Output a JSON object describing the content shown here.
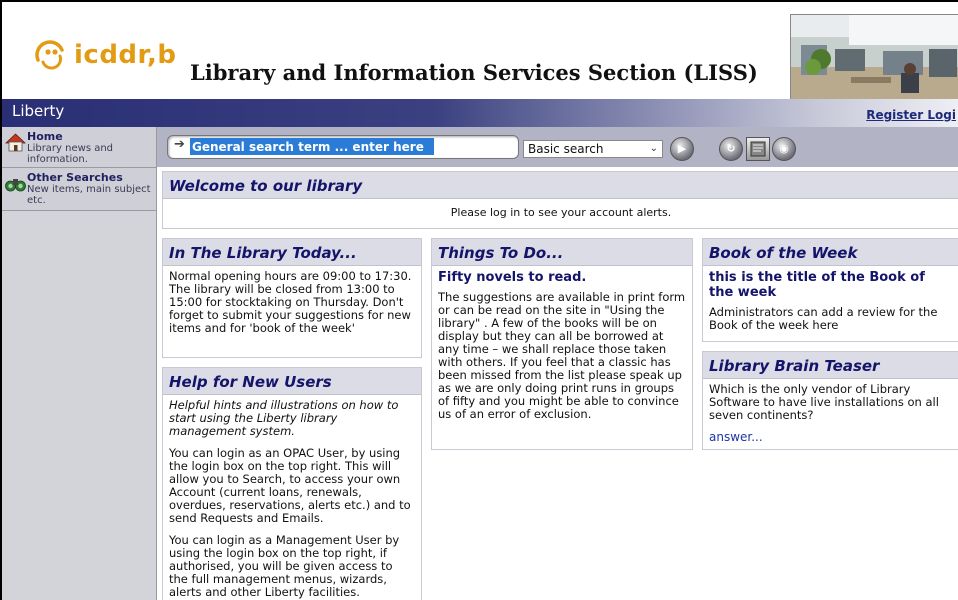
{
  "header": {
    "logo_text": "icddr,b",
    "title": "Library and Information Services Section (LISS)"
  },
  "topbar": {
    "brand": "Liberty",
    "register_login": "Register Logi"
  },
  "nav": {
    "items": [
      {
        "label": "Home",
        "desc": "Library news and information.",
        "icon": "home-icon"
      },
      {
        "label": "Other Searches",
        "desc": "New items, main subject etc.",
        "icon": "binoculars-icon"
      }
    ]
  },
  "search": {
    "input_value": "General search term ... enter here",
    "mode": "Basic search",
    "buttons": [
      "go-icon",
      "refresh-icon",
      "book-icon",
      "globe-icon"
    ]
  },
  "welcome": {
    "title": "Welcome to our library",
    "message": "Please log in to see your account alerts."
  },
  "today": {
    "title": "In The Library Today...",
    "text": "Normal opening hours are 09:00 to 17:30. The library will be closed from 13:00 to 15:00 for stocktaking on Thursday. Don't forget to submit your suggestions for new items and for 'book of the week'"
  },
  "help": {
    "title": "Help for New Users",
    "intro": "Helpful hints and illustrations on how to start using the Liberty library management system.",
    "para1": "You can login as an OPAC User, by using the login box on the top right. This will allow you to Search, to access your own Account (current loans, renewals, overdues, reservations, alerts etc.) and to send Requests and Emails.",
    "para2": "You can login as a Management User by using the login box on the top right, if authorised, you will be given access to the full management menus, wizards, alerts and other Liberty facilities."
  },
  "todo": {
    "title": "Things To Do...",
    "subtitle": "Fifty novels to read.",
    "text": "The suggestions are available in print form or can be read on the site in \"Using the library\" . A few of the books will be on display but they can all be borrowed at any time – we shall replace those taken with others. If you feel that a classic has been missed from the list please speak up as we are only doing print runs in groups of fifty and you might be able to convince us of an error of exclusion."
  },
  "book": {
    "title": "Book of the Week",
    "subtitle": "this is the title of the Book of the week",
    "text": "Administrators can add a review for the Book of the week here"
  },
  "teaser": {
    "title": "Library Brain Teaser",
    "text": "Which is the only vendor of Library Software to have live installations on all seven continents?",
    "link": "answer..."
  },
  "colors": {
    "accent": "#14146a",
    "logo": "#e29b13",
    "search_highlight": "#2a7cd6"
  }
}
